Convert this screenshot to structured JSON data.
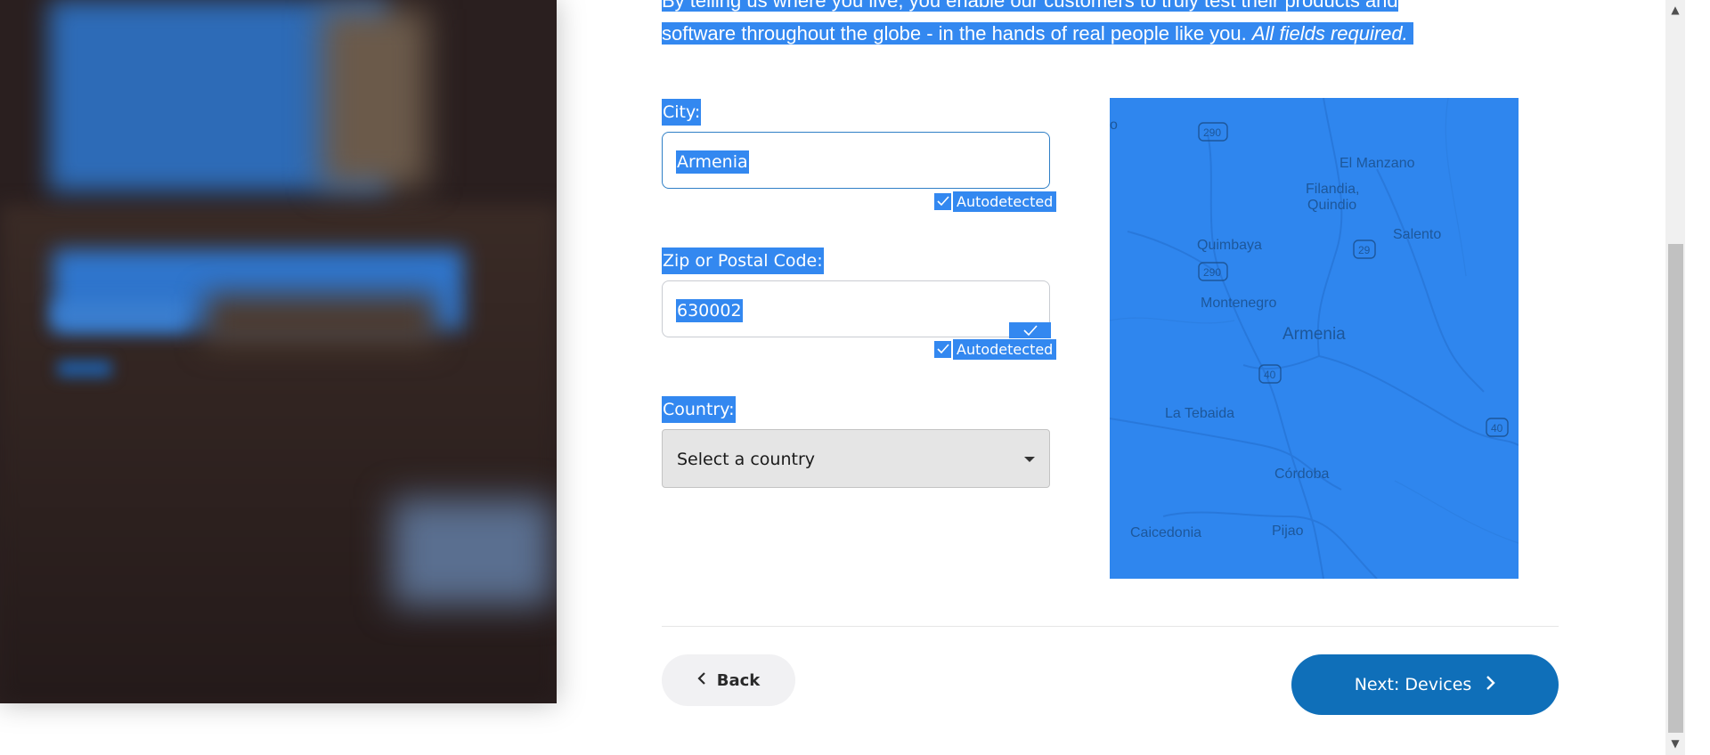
{
  "intro": {
    "line1": "By telling us where you live, you enable our customers to truly test their products and",
    "line2": "software throughout the globe - in the hands of real people like you.",
    "line2_em": "All fields required."
  },
  "city": {
    "label": "City:",
    "value": "Armenia",
    "autodetected": "Autodetected"
  },
  "zip": {
    "label": "Zip or Postal Code:",
    "value": "630002",
    "autodetected": "Autodetected"
  },
  "country": {
    "label": "Country:",
    "value": "Select a country"
  },
  "map": {
    "places": [
      "El Manzano",
      "Filandia,",
      "Quindio",
      "Salento",
      "Quimbaya",
      "Montenegro",
      "Armenia",
      "La Tebaida",
      "Córdoba",
      "Caicedonia",
      "Pijao",
      "o"
    ],
    "shields": [
      "290",
      "290",
      "29",
      "40",
      "40"
    ]
  },
  "nav": {
    "back_label": "Back",
    "next_label": "Next: Devices"
  },
  "colors": {
    "selection": "#3388f0",
    "primary_button": "#0f6fb9"
  }
}
